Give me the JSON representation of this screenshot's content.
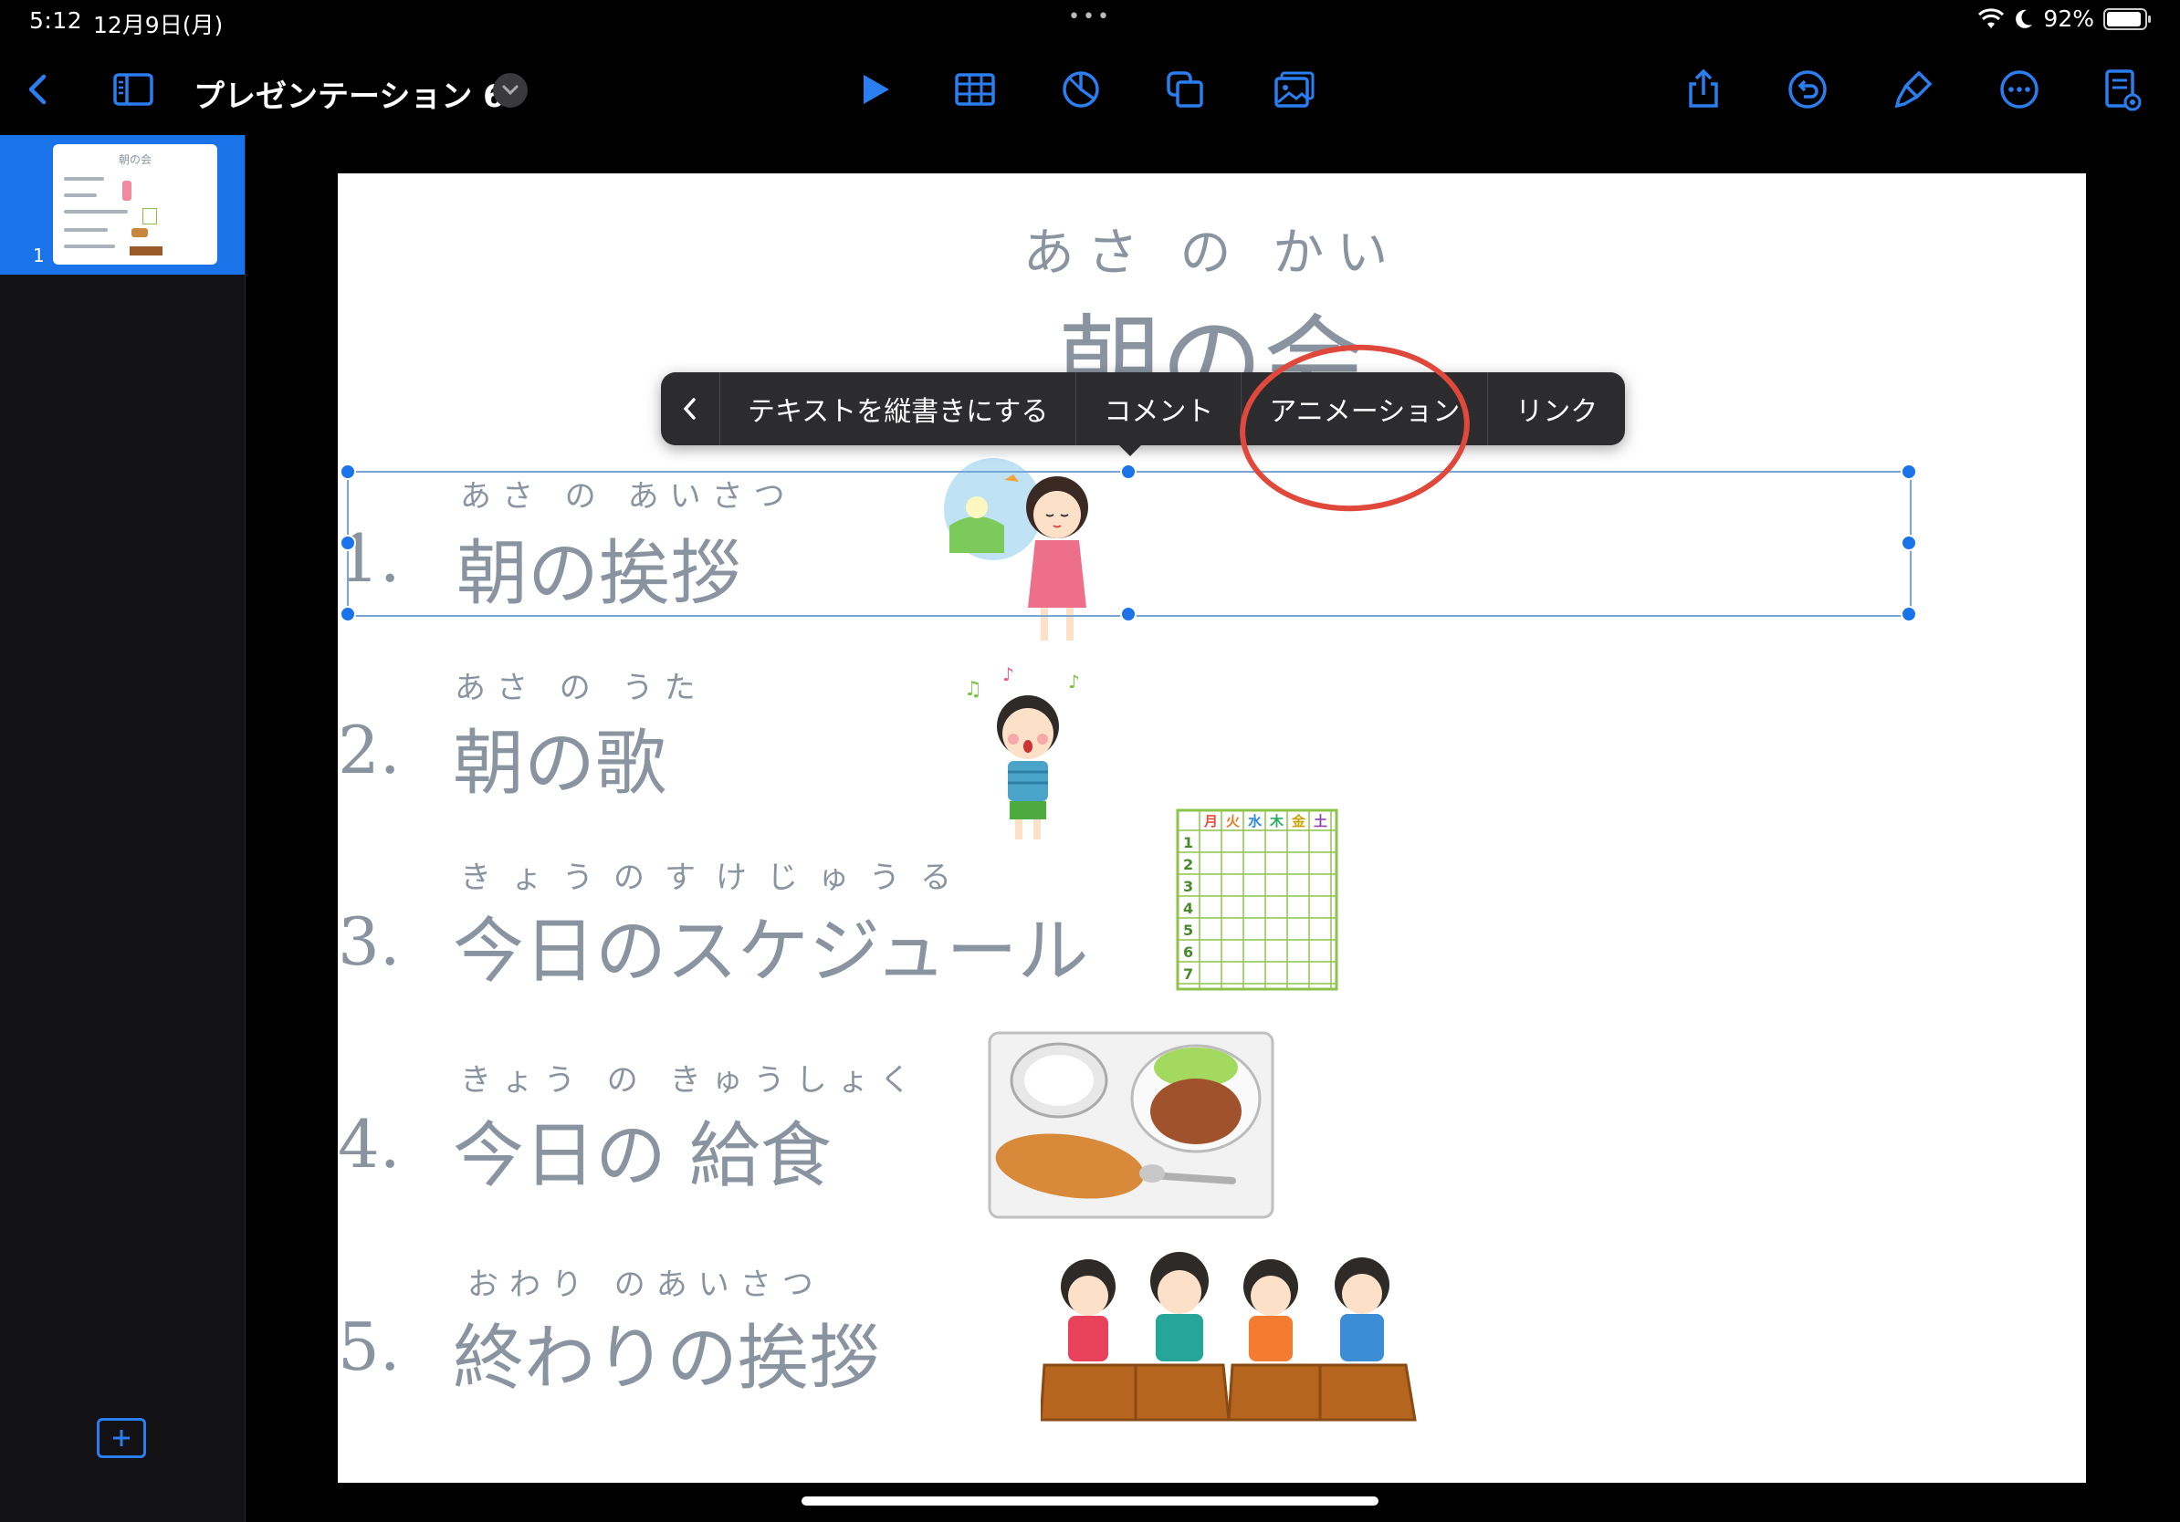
{
  "status_bar": {
    "time": "5:12",
    "date": "12月9日(月)",
    "battery": "92%",
    "battery_level": 0.92
  },
  "toolbar": {
    "document_title": "プレゼンテーション 6",
    "accent_color": "#2a7ef0"
  },
  "navigator": {
    "slides": [
      {
        "number": "1",
        "thumb_title": "朝の会"
      }
    ]
  },
  "slide": {
    "title_ruby": "あさ の かい",
    "title": "朝の会",
    "items": [
      {
        "number": "1.",
        "ruby": "あさ の あいさつ",
        "text": "朝の挨拶"
      },
      {
        "number": "2.",
        "ruby": "あさ の うた",
        "text": "朝の歌"
      },
      {
        "number": "3.",
        "ruby": "きょうのすけじゅうる",
        "text": "今日のスケジュール"
      },
      {
        "number": "4.",
        "ruby": "きょう の きゅうしょく",
        "text": "今日の 給食"
      },
      {
        "number": "5.",
        "ruby": "おわり のあいさつ",
        "text": "終わりの挨拶"
      }
    ],
    "schedule_days": [
      "月",
      "火",
      "水",
      "木",
      "金",
      "土"
    ],
    "schedule_rows": [
      "1",
      "2",
      "3",
      "4",
      "5",
      "6",
      "7"
    ]
  },
  "context_menu": {
    "items": [
      "テキストを縦書きにする",
      "コメント",
      "アニメーション",
      "リンク"
    ]
  },
  "annotation": {
    "highlight_color": "#e0483c"
  }
}
